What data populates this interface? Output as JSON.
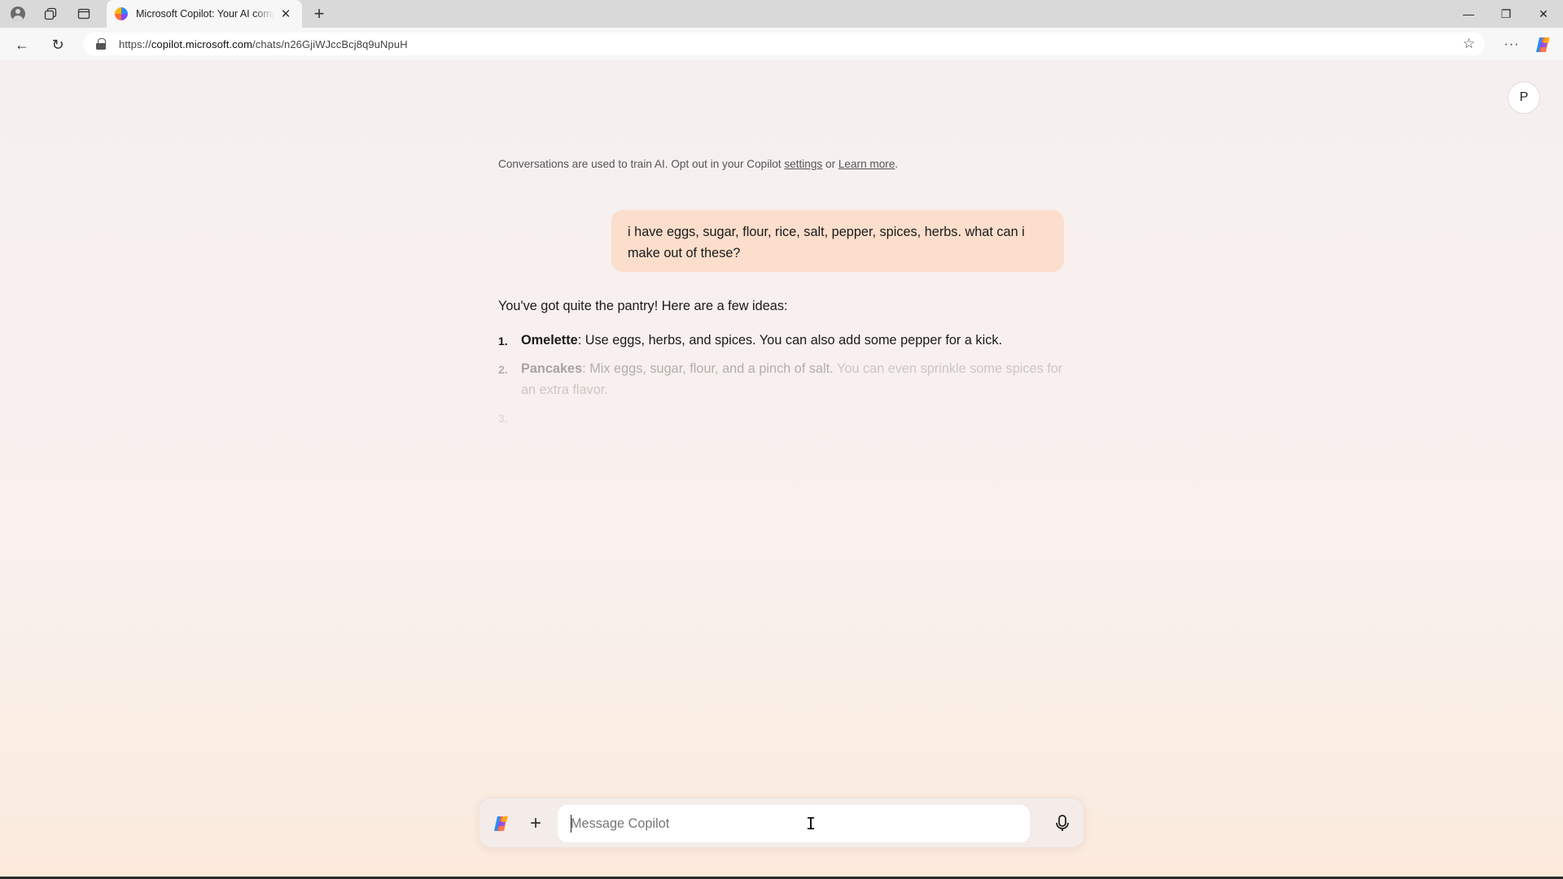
{
  "browser": {
    "tab_title": "Microsoft Copilot: Your AI compa",
    "tab_close_glyph": "✕",
    "new_tab_glyph": "+",
    "url_prefix": "https://",
    "url_host": "copilot.microsoft.com",
    "url_path": "/chats/n26GjiWJccBcj8q9uNpuH",
    "window_controls": {
      "minimize": "—",
      "restore": "❐",
      "close": "✕"
    },
    "more_glyph": "···",
    "star_glyph": "☆",
    "back_glyph": "←",
    "reload_glyph": "↻"
  },
  "user": {
    "avatar_initial": "P"
  },
  "notice": {
    "text": "Conversations are used to train AI. Opt out in your Copilot ",
    "settings_link": "settings",
    "or": " or ",
    "learn_more_link": "Learn more",
    "period": "."
  },
  "conversation": {
    "user_message": "i have eggs, sugar, flour, rice, salt, pepper, spices, herbs. what can i make out of these?",
    "assistant_intro": "You've got quite the pantry! Here are a few ideas:",
    "items": [
      {
        "num": "1.",
        "title": "Omelette",
        "text": ": Use eggs, herbs, and spices. You can also add some pepper for a kick."
      },
      {
        "num": "2.",
        "title": "Pancakes",
        "text": ": Mix eggs, sugar, flour, and a pinch of salt.",
        "faded_text": " You can even sprinkle some spices for an extra flavor."
      },
      {
        "num": "3.",
        "title": "",
        "text": ""
      }
    ]
  },
  "composer": {
    "placeholder": "Message Copilot",
    "plus_glyph": "+"
  },
  "colors": {
    "user_bubble": "#fbdecb",
    "page_bg_top": "#f6eff0",
    "page_bg_bottom": "#fbeadc"
  }
}
